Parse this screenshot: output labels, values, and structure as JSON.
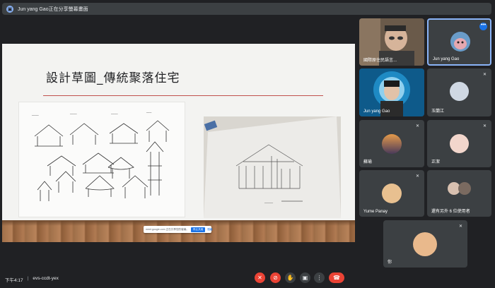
{
  "presenter": {
    "label": "Jun yang Gao正在分享螢幕畫面"
  },
  "slide": {
    "title": "設計草圖_傳統聚落住宅"
  },
  "share_bar": {
    "text": "meet.google.com 正在共享您的螢幕。",
    "stop_label": "停止共用",
    "hide_label": "隱藏"
  },
  "participants": [
    {
      "name": "國際原住民語言..."
    },
    {
      "name": "Jun yang Gao"
    },
    {
      "name": "Jun yang Gao"
    },
    {
      "name": "玉蘭江"
    },
    {
      "name": "蘇瑜"
    },
    {
      "name": "正潔"
    },
    {
      "name": "Yume Panay"
    },
    {
      "name": "還有另外 6 位使用者"
    },
    {
      "name": "你"
    }
  ],
  "footer": {
    "time": "下午4:17",
    "sep": "|",
    "meeting_code": "evs-ccdt-yex"
  },
  "icons": {
    "mic_off": "mic-off-icon",
    "cam_off": "camera-off-icon",
    "raise_hand": "hand-icon",
    "present": "present-icon",
    "more": "more-vert-icon",
    "hangup": "hangup-icon"
  },
  "colors": {
    "background": "#202124",
    "tile": "#3c4043",
    "accent": "#8ab4f8",
    "danger": "#ea4335",
    "slide_rule": "#c0504d"
  }
}
